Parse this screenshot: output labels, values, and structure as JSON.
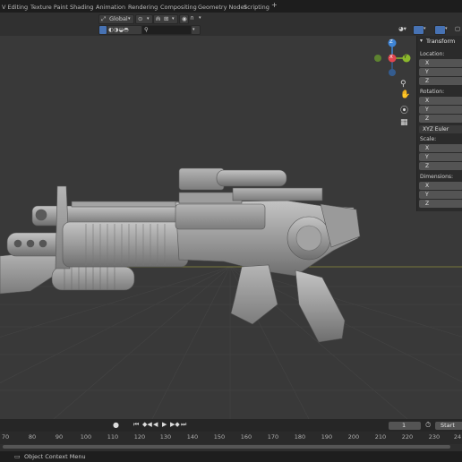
{
  "tabs": [
    "V Editing",
    "Texture Paint",
    "Shading",
    "Animation",
    "Rendering",
    "Compositing",
    "Geometry Nodes",
    "Scripting"
  ],
  "tab_plus": "+",
  "header": {
    "orientation": "Global",
    "search_placeholder": ""
  },
  "gizmo": {
    "z": "Z",
    "x": "X",
    "y": "Y"
  },
  "npanel": {
    "title": "Transform",
    "location_label": "Location:",
    "rotation_label": "Rotation:",
    "rotation_mode": "XYZ Euler",
    "scale_label": "Scale:",
    "dimensions_label": "Dimensions:",
    "axis": [
      "X",
      "Y",
      "Z"
    ]
  },
  "timeline": {
    "current_frame": "1",
    "start_label": "Start",
    "ticks": [
      "70",
      "80",
      "90",
      "100",
      "110",
      "120",
      "130",
      "140",
      "150",
      "160",
      "170",
      "180",
      "190",
      "200",
      "210",
      "220",
      "230",
      "24"
    ]
  },
  "status": {
    "text": "Object Context Menu"
  },
  "colors": {
    "accent": "#4772b3",
    "x_axis": "#e2454f",
    "y_axis": "#8bb82c",
    "z_axis": "#3f85d6"
  }
}
